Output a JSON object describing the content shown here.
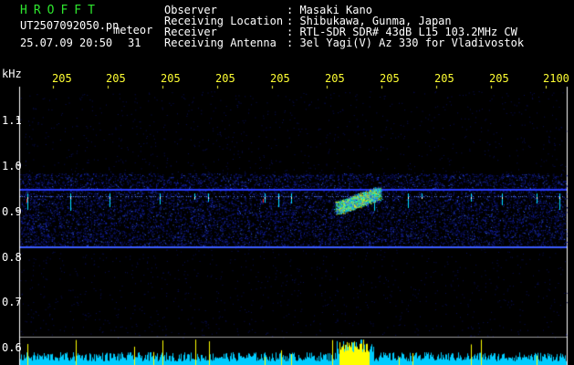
{
  "header": {
    "app_name": "HROFFT",
    "filename": "UT2507092050.pn",
    "mode": "meteor",
    "datetime": "25.07.09 20:50",
    "seconds": "31",
    "info": [
      {
        "key": "Observer",
        "value": ": Masaki Kano"
      },
      {
        "key": "Receiving Location",
        "value": ": Shibukawa, Gunma, Japan"
      },
      {
        "key": "Receiver",
        "value": ": RTL-SDR SDR# 43dB L15 103.2MHz CW"
      },
      {
        "key": "Receiving Antenna",
        "value": ": 3el Yagi(V) Az 330 for Vladivostok"
      }
    ]
  },
  "axis": {
    "unit": "kHz",
    "x_ticks": [
      "205",
      "205",
      "205",
      "205",
      "205",
      "205",
      "205",
      "205",
      "205",
      "2100"
    ],
    "y_ticks": [
      "1.1",
      "1.0",
      "0.9",
      "0.8",
      "0.7",
      "0.6"
    ]
  },
  "colors": {
    "background": "#000000",
    "noise": "#1a2bd6",
    "signal_hot": "#ffee00",
    "signal_mid": "#00e0ff",
    "bottom_bars": "#00ccff",
    "bottom_spikes": "#ffff00",
    "grid": "#9a9a9a"
  }
}
